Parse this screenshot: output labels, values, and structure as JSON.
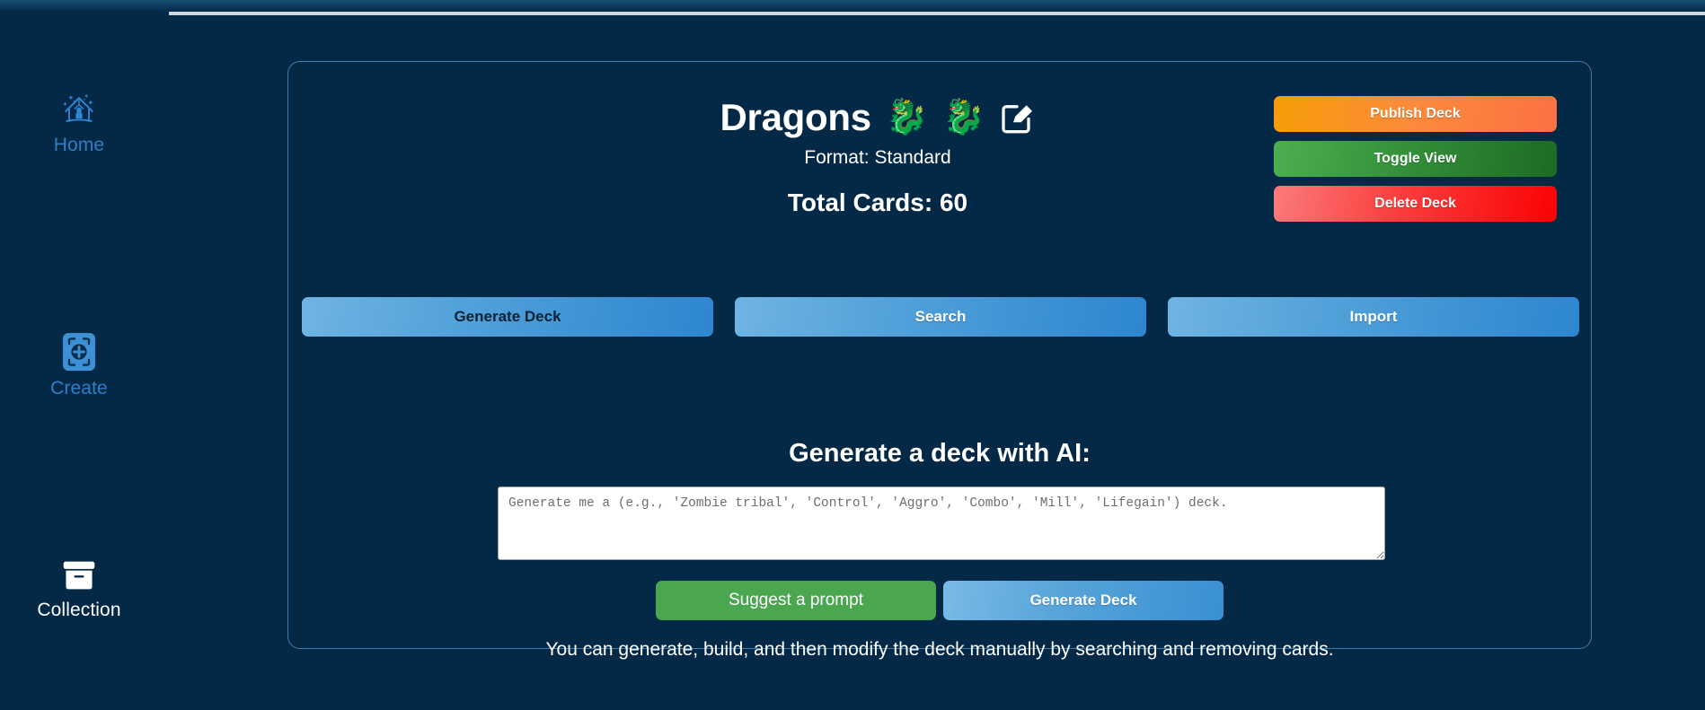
{
  "theme": {
    "page_bg": "#042947",
    "panel_border": "#3e7cad",
    "accent_blue": "#2f7fc6",
    "publish_color": "#f79d07",
    "toggle_color": "#2f8a36",
    "delete_color": "#fa0202",
    "suggest_green": "#4aa64f",
    "divider_color": "#d2d6dc"
  },
  "sidebar": {
    "items": [
      {
        "id": "home",
        "label": "Home",
        "icon": "house-sparkle-icon"
      },
      {
        "id": "create",
        "label": "Create",
        "icon": "card-plus-icon"
      },
      {
        "id": "collection",
        "label": "Collection",
        "icon": "archive-box-icon"
      }
    ]
  },
  "deck": {
    "title": "Dragons",
    "emoji_1": "🐉",
    "emoji_2": "🐉",
    "edit_icon": "pencil-square-icon",
    "format_label": "Format: Standard",
    "total_cards_label": "Total Cards: 60"
  },
  "side_actions": [
    {
      "id": "publish",
      "label": "Publish Deck"
    },
    {
      "id": "toggle",
      "label": "Toggle View"
    },
    {
      "id": "delete",
      "label": "Delete Deck"
    }
  ],
  "action_row": [
    {
      "id": "generate-deck",
      "label": "Generate Deck",
      "text_style": "dark"
    },
    {
      "id": "search",
      "label": "Search",
      "text_style": "light"
    },
    {
      "id": "import",
      "label": "Import",
      "text_style": "light"
    }
  ],
  "ai": {
    "heading": "Generate a deck with AI:",
    "prompt_value": "",
    "prompt_placeholder": "Generate me a (e.g., 'Zombie tribal', 'Control', 'Aggro', 'Combo', 'Mill', 'Lifegain') deck.",
    "suggest_label": "Suggest a prompt",
    "generate_label": "Generate Deck",
    "note": "You can generate, build, and then modify the deck manually by searching and removing cards."
  }
}
